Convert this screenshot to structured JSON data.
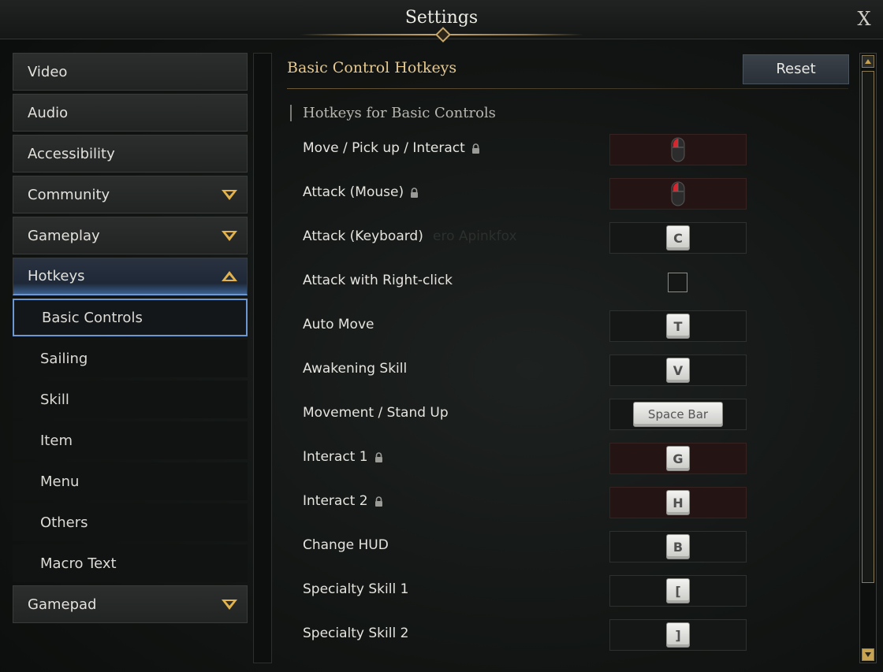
{
  "window": {
    "title": "Settings",
    "close_label": "X"
  },
  "sidebar": {
    "categories_top": [
      {
        "label": "Video"
      },
      {
        "label": "Audio"
      },
      {
        "label": "Accessibility"
      },
      {
        "label": "Community",
        "chevron": "down"
      },
      {
        "label": "Gameplay",
        "chevron": "down"
      }
    ],
    "hotkeys": {
      "label": "Hotkeys",
      "chevron": "up",
      "items": [
        {
          "label": "Basic Controls",
          "selected": true
        },
        {
          "label": "Sailing"
        },
        {
          "label": "Skill"
        },
        {
          "label": "Item"
        },
        {
          "label": "Menu"
        },
        {
          "label": "Others"
        },
        {
          "label": "Macro Text"
        }
      ]
    },
    "gamepad": {
      "label": "Gamepad",
      "chevron": "down"
    }
  },
  "main": {
    "section_title": "Basic Control Hotkeys",
    "reset_label": "Reset",
    "subheading": "Hotkeys for Basic Controls",
    "rows": [
      {
        "label": "Move / Pick up / Interact",
        "locked": true,
        "binding": "left-mouse-button-icon"
      },
      {
        "label": "Attack (Mouse)",
        "locked": true,
        "binding": "left-mouse-button-icon"
      },
      {
        "label": "Attack (Keyboard)",
        "locked": false,
        "key": "C"
      },
      {
        "label": "Attack with Right-click",
        "checkbox": true,
        "checked": false
      },
      {
        "label": "Auto Move",
        "locked": false,
        "key": "T"
      },
      {
        "label": "Awakening Skill",
        "locked": false,
        "key": "V"
      },
      {
        "label": "Movement / Stand Up",
        "locked": false,
        "key": "Space Bar"
      },
      {
        "label": "Interact 1",
        "locked": true,
        "key": "G"
      },
      {
        "label": "Interact 2",
        "locked": true,
        "key": "H"
      },
      {
        "label": "Change HUD",
        "locked": false,
        "key": "B"
      },
      {
        "label": "Specialty Skill 1",
        "locked": false,
        "key": "["
      },
      {
        "label": "Specialty Skill 2",
        "locked": false,
        "key": "]"
      }
    ],
    "background_text": "ero Apinkfox"
  },
  "colors": {
    "accent_gold": "#e2b34d",
    "section_title": "#e7c98f",
    "selected_border": "#6c97d1",
    "locked_slot": "#241514"
  }
}
